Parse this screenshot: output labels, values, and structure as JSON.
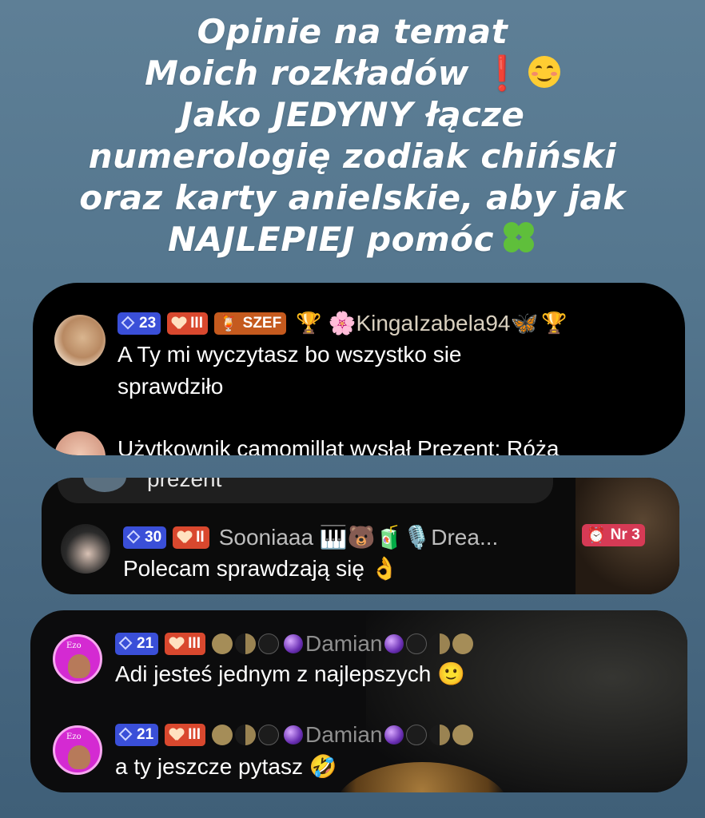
{
  "headline": {
    "lines": [
      "Opinie na temat",
      "Moich rozkładów",
      "Jako JEDYNY łącze",
      "numerologię zodiak chiński",
      "oraz karty anielskie, aby jak",
      "NAJLEPIEJ pomóc"
    ],
    "exclaim": "❗"
  },
  "comments": [
    {
      "level": "23",
      "fan_level": "III",
      "role_badge": "SZEF",
      "username": "🌸KingaIzabela94🦋",
      "message_line1": "A Ty mi wyczytasz bo wszystko sie",
      "message_line2": "sprawdziło"
    },
    {
      "cut_message": "Użytkownik camomillat wysłał Prezent: Róża"
    },
    {
      "cut_text": "prezent",
      "level": "30",
      "fan_level": "II",
      "username": "Sooniaaa 🎹🐻🧃🎙️Drea...",
      "rank_badge": "Nr 3",
      "message": "Polecam sprawdzają się 👌"
    },
    {
      "level": "21",
      "fan_level": "III",
      "username": "Damian",
      "message": "Adi jesteś jednym z najlepszych 🙂",
      "avatar_label": "Ezo"
    },
    {
      "level": "21",
      "fan_level": "III",
      "username": "Damian",
      "message": "a ty jeszcze pytasz 🤣",
      "avatar_label": "Ezo"
    }
  ],
  "colors": {
    "background_top": "#5e7f96",
    "background_bottom": "#3f5f78",
    "level_badge": "#3a4fd8",
    "fan_badge": "#d9482e",
    "rank_badge": "#d63a55"
  }
}
